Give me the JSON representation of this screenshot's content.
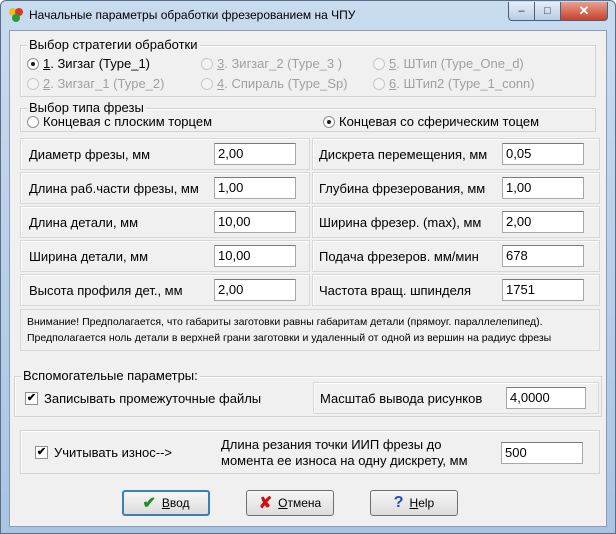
{
  "window": {
    "title": "Начальные параметры обработки фрезерованием на ЧПУ",
    "minimize": "–",
    "maximize": "□",
    "close": "✕"
  },
  "strategy": {
    "legend": "Выбор стратегии обработки",
    "options": [
      {
        "mnemonic": "1",
        "label": ". Зигзаг     (Type_1)",
        "checked": true,
        "enabled": true
      },
      {
        "mnemonic": "2",
        "label": ". Зигзаг_1 (Type_2)",
        "checked": false,
        "enabled": false
      },
      {
        "mnemonic": "3",
        "label": ". Зигзаг_2 (Type_3  )",
        "checked": false,
        "enabled": false
      },
      {
        "mnemonic": "4",
        "label": ". Спираль (Type_Sp)",
        "checked": false,
        "enabled": false
      },
      {
        "mnemonic": "5",
        "label": ". ШТип   (Type_One_d)",
        "checked": false,
        "enabled": false
      },
      {
        "mnemonic": "6",
        "label": ". ШТип2 (Type_1_conn)",
        "checked": false,
        "enabled": false
      }
    ]
  },
  "cutter_type": {
    "legend": "Выбор типа фрезы",
    "options": [
      {
        "label": "Концевая с плоским торцем",
        "checked": false
      },
      {
        "label": "Концевая со сферическим тоцем",
        "checked": true
      }
    ]
  },
  "params_left": [
    {
      "label": "Диаметр фрезы, мм",
      "value": "2,00"
    },
    {
      "label": "Длина раб.части фрезы, мм",
      "value": "1,00"
    },
    {
      "label": "Длина детали, мм",
      "value": "10,00"
    },
    {
      "label": "Ширина детали, мм",
      "value": "10,00"
    },
    {
      "label": "Высота профиля дет., мм",
      "value": "2,00"
    }
  ],
  "params_right": [
    {
      "label": "Дискрета перемещения, мм",
      "value": "0,05"
    },
    {
      "label": "Глубина фрезерования, мм",
      "value": "1,00"
    },
    {
      "label": "Ширина фрезер. (max), мм",
      "value": "2,00"
    },
    {
      "label": "Подача фрезеров. мм/мин",
      "value": "678"
    },
    {
      "label": "Частота вращ. шпинделя",
      "value": "1751"
    }
  ],
  "note": {
    "line1": "Внимание! Предполагается, что габариты заготовки равны габаритам детали (прямоуг. параллелепипед).",
    "line2": "Предполагается ноль детали в верхней грани заготовки и удаленный от одной из вершин  на радиус фрезы"
  },
  "aux": {
    "legend": "Вспомогательые параметры:",
    "write_files_label": "Записывать промежуточные  файлы",
    "write_files_checked": true,
    "scale_label": "Масштаб вывода рисунков",
    "scale_value": "4,0000"
  },
  "wear": {
    "label": "Учитывать износ-->",
    "checked": true,
    "length_label_line1": "Длина резания точки ИИП фрезы до",
    "length_label_line2": "момента ее износа на одну дискрету, мм",
    "length_value": "500"
  },
  "buttons": {
    "ok_mnemonic": "В",
    "ok_rest": "вод",
    "cancel_mnemonic": "О",
    "cancel_rest": "тмена",
    "help_mnemonic": "Н",
    "help_rest": "elp"
  },
  "icons": {
    "check": "✔",
    "cross": "✘",
    "help": "?"
  },
  "colors": {
    "ok_icon": "#1f8f1f",
    "cancel_icon": "#d01010",
    "help_icon": "#1a4fbf"
  }
}
